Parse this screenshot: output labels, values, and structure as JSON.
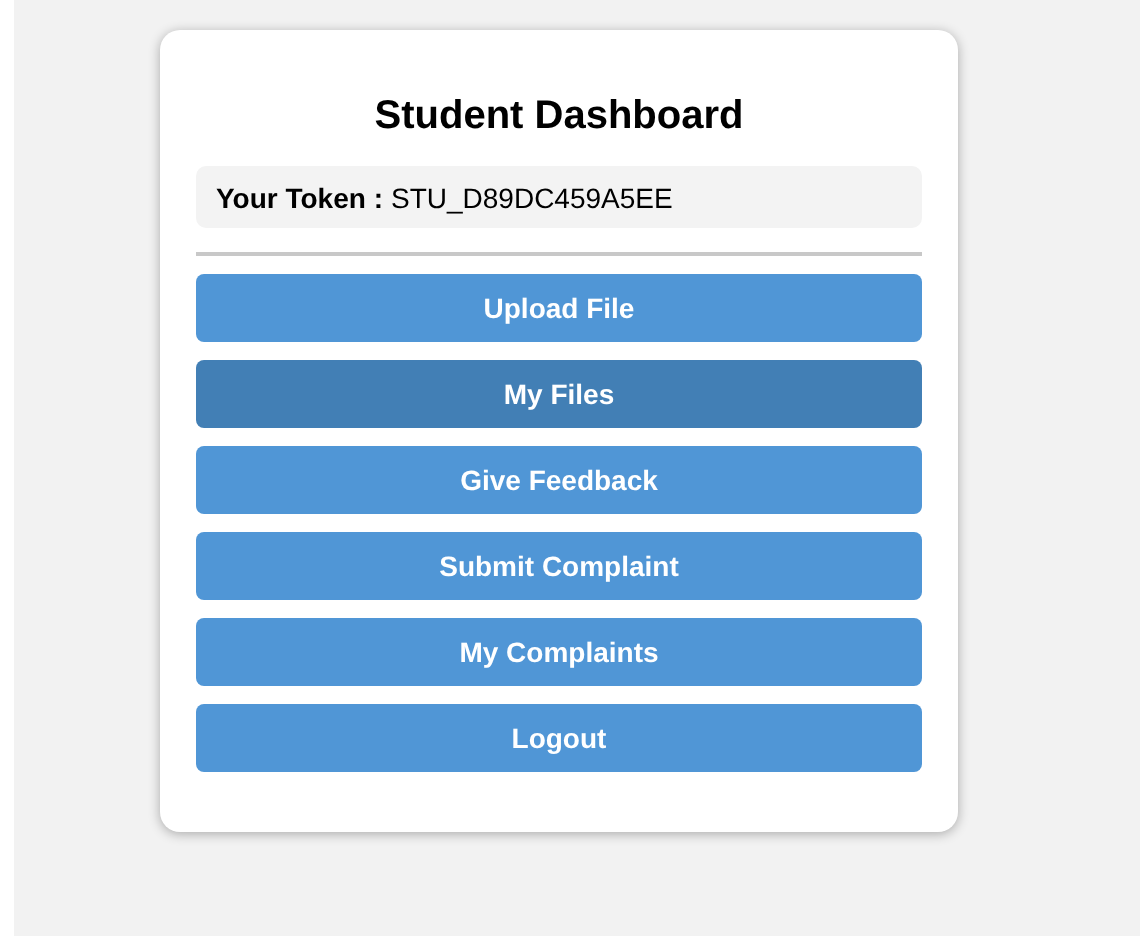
{
  "title": "Student Dashboard",
  "token": {
    "label": "Your Token :",
    "value": "STU_D89DC459A5EE"
  },
  "buttons": [
    {
      "label": "Upload File",
      "selected": false
    },
    {
      "label": "My Files",
      "selected": true
    },
    {
      "label": "Give Feedback",
      "selected": false
    },
    {
      "label": "Submit Complaint",
      "selected": false
    },
    {
      "label": "My Complaints",
      "selected": false
    },
    {
      "label": "Logout",
      "selected": false
    }
  ]
}
